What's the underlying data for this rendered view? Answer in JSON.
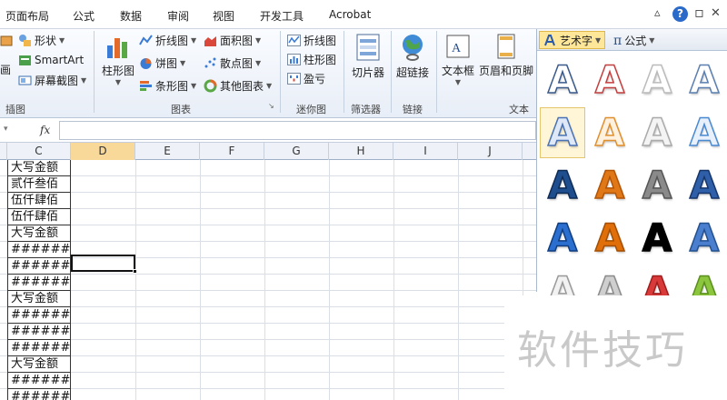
{
  "tabs": [
    "页面布局",
    "公式",
    "数据",
    "审阅",
    "视图",
    "开发工具",
    "Acrobat"
  ],
  "window_controls": {
    "minimize": "▵",
    "close": "✕",
    "restore": "▫"
  },
  "ribbon": {
    "illustrations": {
      "shapes": "形状",
      "smartart": "SmartArt",
      "screenshot": "屏幕截图",
      "clip_partial": "画",
      "label": "插图"
    },
    "charts": {
      "column": "柱形图",
      "line": "折线图",
      "pie": "饼图",
      "bar": "条形图",
      "area": "面积图",
      "scatter": "散点图",
      "other": "其他图表",
      "label": "图表"
    },
    "sparklines": {
      "line": "折线图",
      "column": "柱形图",
      "winloss": "盈亏",
      "label": "迷你图"
    },
    "filter": {
      "slicer": "切片器",
      "label": "筛选器"
    },
    "links": {
      "hyperlink": "超链接",
      "label": "链接"
    },
    "text": {
      "textbox": "文本框",
      "header_footer": "页眉和页脚",
      "label": "文本"
    }
  },
  "formula_bar": {
    "fx": "fx",
    "value": ""
  },
  "columns": [
    "C",
    "D",
    "E",
    "F",
    "G",
    "H",
    "I",
    "J"
  ],
  "selected_column": "D",
  "cells_c": [
    "大写金额",
    "贰仟叁佰",
    "伍仟肆佰",
    "伍仟肆佰",
    "大写金额",
    "########",
    "########",
    "########",
    "大写金额",
    "########",
    "########",
    "########",
    "大写金额",
    "########",
    "########"
  ],
  "gallery": {
    "arttext_label": "艺术字",
    "formula_label": "公式",
    "letter": "A",
    "items": [
      {
        "fill": "#ffffff",
        "stroke": "#3a5a8c"
      },
      {
        "fill": "#ffffff",
        "stroke": "#c44040"
      },
      {
        "fill": "#ffffff",
        "stroke": "#bbbbbb"
      },
      {
        "fill": "#ffffff",
        "stroke": "#5b7fb0"
      },
      {
        "fill": "#dfe8f6",
        "stroke": "#4a73b5"
      },
      {
        "fill": "#fff1e0",
        "stroke": "#e0902f"
      },
      {
        "fill": "#f4f4f4",
        "stroke": "#aaaaaa"
      },
      {
        "fill": "#e8f0fb",
        "stroke": "#4a8ad2"
      },
      {
        "fill": "#1f4e8f",
        "stroke": "#0e2b55"
      },
      {
        "fill": "#e07818",
        "stroke": "#b35405"
      },
      {
        "fill": "#8a8a8a",
        "stroke": "#555555"
      },
      {
        "fill": "#2f5fa8",
        "stroke": "#15356b"
      },
      {
        "fill": "#2a6fcf",
        "stroke": "#103d80"
      },
      {
        "fill": "#e06f0a",
        "stroke": "#a34e00"
      },
      {
        "fill": "#000000",
        "stroke": "#000000"
      },
      {
        "fill": "#4a7ecf",
        "stroke": "#23508f"
      },
      {
        "fill": "#f2f2f2",
        "stroke": "#999999"
      },
      {
        "fill": "#cfcfcf",
        "stroke": "#8a8a8a"
      },
      {
        "fill": "#d83a3a",
        "stroke": "#a01d1d"
      },
      {
        "fill": "#8cc63f",
        "stroke": "#5b8f1c"
      }
    ]
  },
  "watermark": "软件技巧"
}
